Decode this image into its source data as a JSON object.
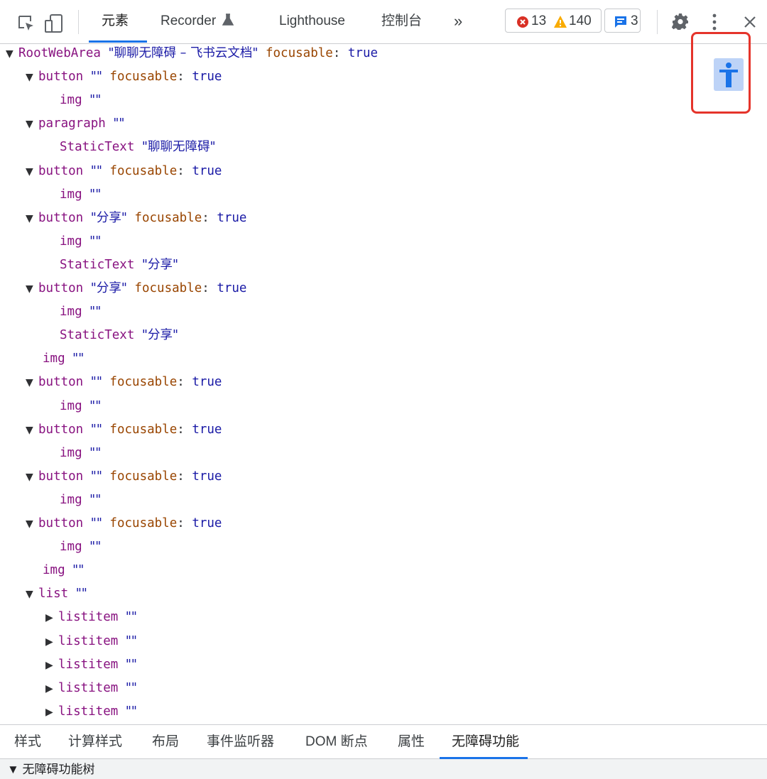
{
  "toolbar": {
    "tabs": [
      {
        "label": "元素",
        "active": true
      },
      {
        "label": "Recorder",
        "active": false
      },
      {
        "label": "Lighthouse",
        "active": false
      },
      {
        "label": "控制台",
        "active": false
      }
    ],
    "more_tabs": "»",
    "errors_count": "13",
    "warnings_count": "140",
    "messages_count": "3",
    "icons": [
      "inspect-icon",
      "device-toggle-icon",
      "flask-icon",
      "error-icon",
      "warning-icon",
      "message-icon",
      "gear-icon",
      "kebab-menu-icon",
      "close-icon"
    ]
  },
  "tree": [
    {
      "indent": 0,
      "tri": "▼",
      "role": "RootWebArea",
      "name": "\"聊聊无障碍 – 飞书云文档\"",
      "prop": "focusable",
      "val": "true"
    },
    {
      "indent": 1,
      "tri": "▼",
      "role": "button",
      "name": "\"\"",
      "prop": "focusable",
      "val": "true"
    },
    {
      "indent": 2,
      "tri": "",
      "role": "img",
      "name": "\"\""
    },
    {
      "indent": 1,
      "tri": "▼",
      "role": "paragraph",
      "name": "\"\""
    },
    {
      "indent": 2,
      "tri": "",
      "role": "StaticText",
      "name": "\"聊聊无障碍\""
    },
    {
      "indent": 1,
      "tri": "▼",
      "role": "button",
      "name": "\"\"",
      "prop": "focusable",
      "val": "true"
    },
    {
      "indent": 2,
      "tri": "",
      "role": "img",
      "name": "\"\""
    },
    {
      "indent": 1,
      "tri": "▼",
      "role": "button",
      "name": "\"分享\"",
      "prop": "focusable",
      "val": "true"
    },
    {
      "indent": 2,
      "tri": "",
      "role": "img",
      "name": "\"\""
    },
    {
      "indent": 2,
      "tri": "",
      "role": "StaticText",
      "name": "\"分享\""
    },
    {
      "indent": 1,
      "tri": "▼",
      "role": "button",
      "name": "\"分享\"",
      "prop": "focusable",
      "val": "true"
    },
    {
      "indent": 2,
      "tri": "",
      "role": "img",
      "name": "\"\""
    },
    {
      "indent": 2,
      "tri": "",
      "role": "StaticText",
      "name": "\"分享\""
    },
    {
      "indent": 1.5,
      "tri": "",
      "role": "img",
      "name": "\"\""
    },
    {
      "indent": 1,
      "tri": "▼",
      "role": "button",
      "name": "\"\"",
      "prop": "focusable",
      "val": "true"
    },
    {
      "indent": 2,
      "tri": "",
      "role": "img",
      "name": "\"\""
    },
    {
      "indent": 1,
      "tri": "▼",
      "role": "button",
      "name": "\"\"",
      "prop": "focusable",
      "val": "true"
    },
    {
      "indent": 2,
      "tri": "",
      "role": "img",
      "name": "\"\""
    },
    {
      "indent": 1,
      "tri": "▼",
      "role": "button",
      "name": "\"\"",
      "prop": "focusable",
      "val": "true"
    },
    {
      "indent": 2,
      "tri": "",
      "role": "img",
      "name": "\"\""
    },
    {
      "indent": 1,
      "tri": "▼",
      "role": "button",
      "name": "\"\"",
      "prop": "focusable",
      "val": "true"
    },
    {
      "indent": 2,
      "tri": "",
      "role": "img",
      "name": "\"\""
    },
    {
      "indent": 1.5,
      "tri": "",
      "role": "img",
      "name": "\"\""
    },
    {
      "indent": 1,
      "tri": "▼",
      "role": "list",
      "name": "\"\""
    },
    {
      "indent": 2,
      "tri": "▶",
      "role": "listitem",
      "name": "\"\""
    },
    {
      "indent": 2,
      "tri": "▶",
      "role": "listitem",
      "name": "\"\""
    },
    {
      "indent": 2,
      "tri": "▶",
      "role": "listitem",
      "name": "\"\""
    },
    {
      "indent": 2,
      "tri": "▶",
      "role": "listitem",
      "name": "\"\""
    },
    {
      "indent": 2,
      "tri": "▶",
      "role": "listitem",
      "name": "\"\""
    }
  ],
  "bottom_tabs": [
    {
      "label": "样式",
      "active": false
    },
    {
      "label": "计算样式",
      "active": false
    },
    {
      "label": "布局",
      "active": false
    },
    {
      "label": "事件监听器",
      "active": false
    },
    {
      "label": "DOM 断点",
      "active": false
    },
    {
      "label": "属性",
      "active": false
    },
    {
      "label": "无障碍功能",
      "active": true
    }
  ],
  "tree_header": "▼ 无障碍功能树",
  "colors": {
    "accent": "#1a73e8",
    "highlight_box": "#e5342b",
    "role": "#881280",
    "prop": "#994500",
    "value": "#1a1aa6"
  }
}
